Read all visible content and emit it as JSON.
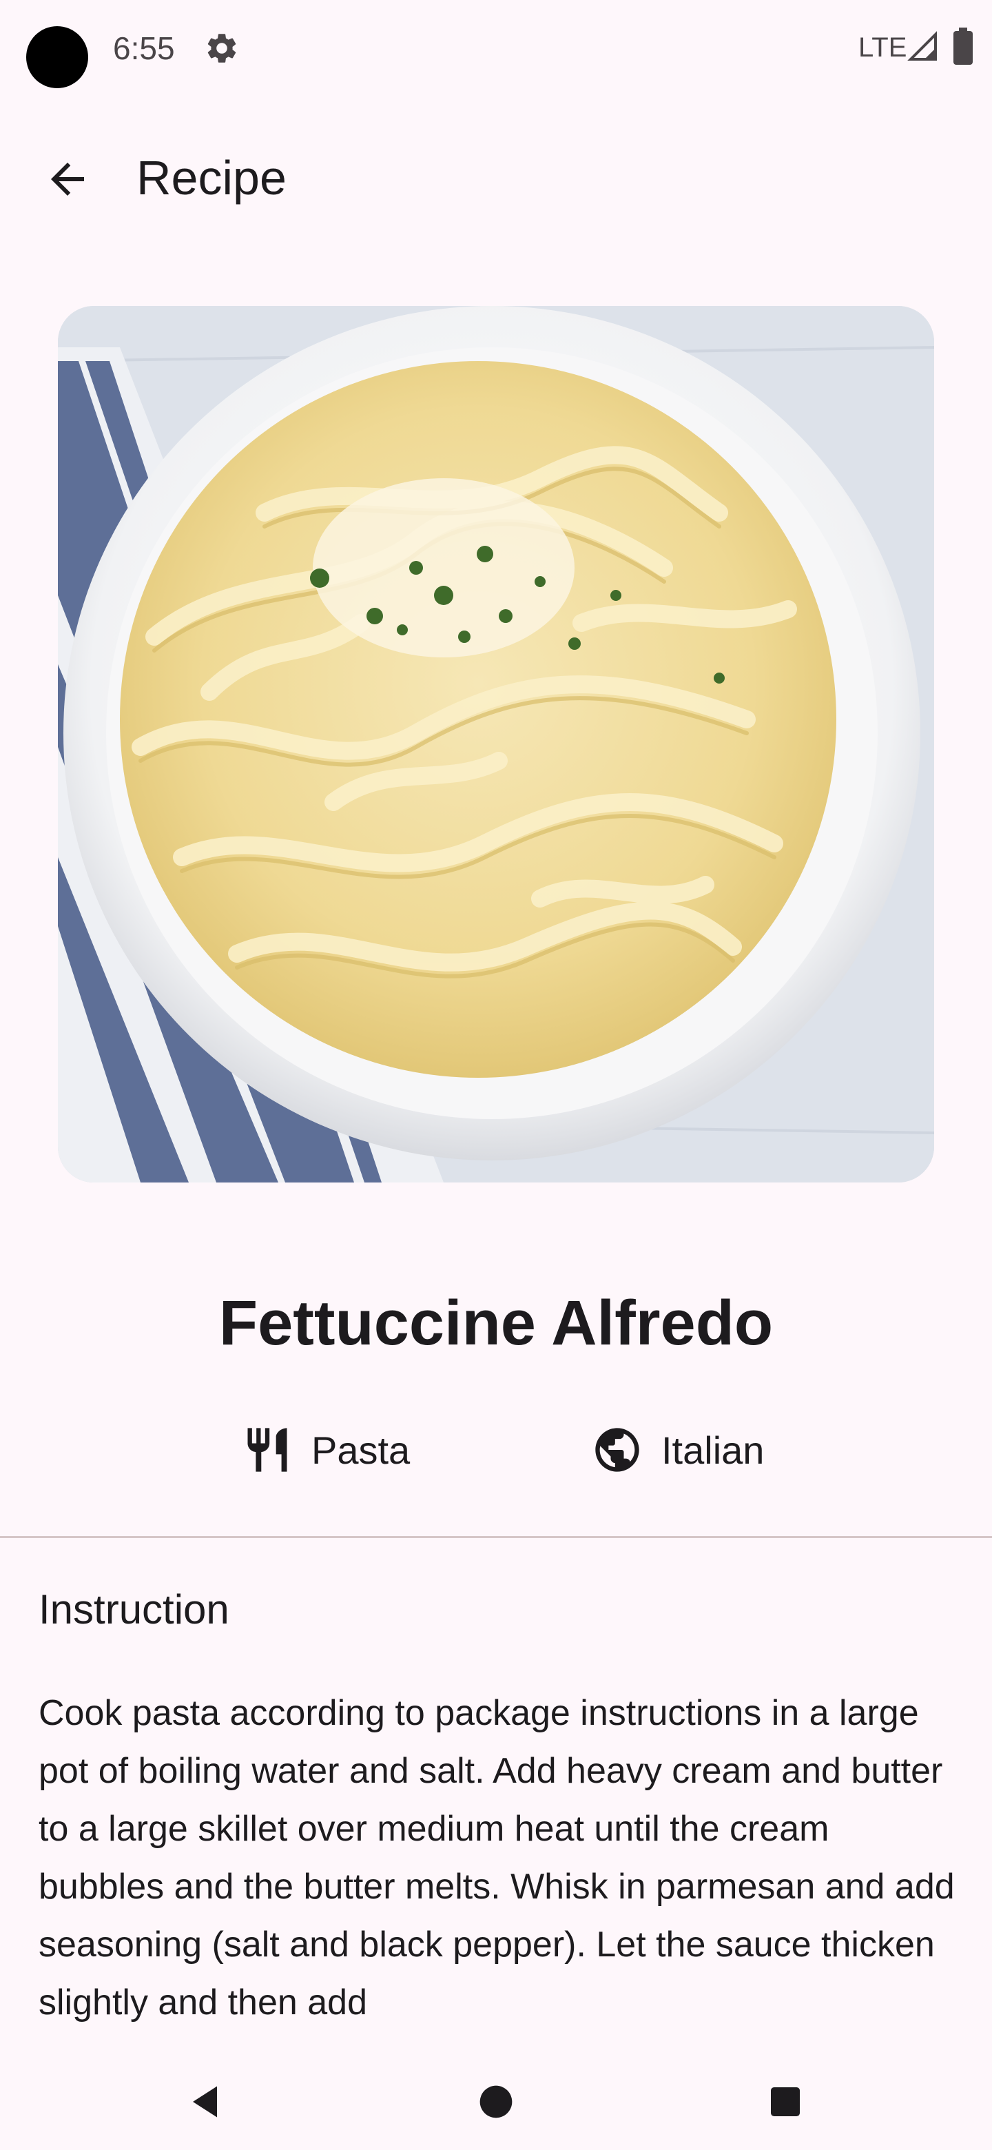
{
  "status_bar": {
    "time": "6:55",
    "network": "LTE",
    "icons": [
      "settings-icon",
      "signal-icon",
      "battery-icon"
    ]
  },
  "app_bar": {
    "title": "Recipe",
    "back_icon": "arrow-back-icon"
  },
  "recipe": {
    "name": "Fettuccine Alfredo",
    "category": "Pasta",
    "category_icon": "utensils-icon",
    "area": "Italian",
    "area_icon": "globe-icon",
    "image_alt": "fettuccine-alfredo-photo"
  },
  "instructions": {
    "heading": "Instruction",
    "text": "Cook pasta according to package instructions in a large pot of boiling water and salt. Add heavy cream and butter to a large skillet over medium heat until the cream bubbles and the butter melts. Whisk in parmesan and add seasoning (salt and black pepper). Let the sauce thicken slightly and then add"
  },
  "nav_bar": {
    "buttons": [
      "back-triangle",
      "home-circle",
      "recents-square"
    ]
  },
  "colors": {
    "background": "#fef7fb",
    "text": "#1d1b1e",
    "divider": "#d6c6c7"
  }
}
